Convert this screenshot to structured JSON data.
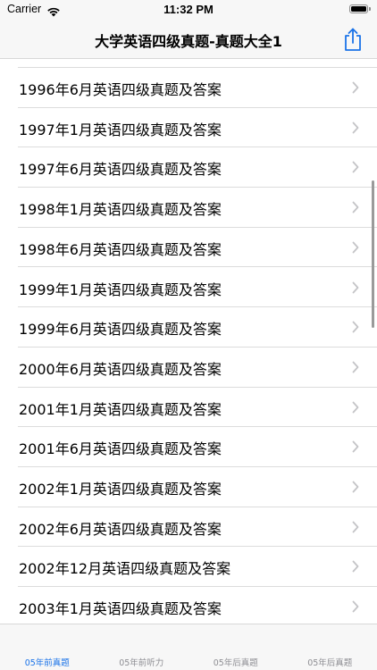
{
  "status_bar": {
    "carrier": "Carrier",
    "time": "11:32 PM"
  },
  "nav": {
    "title": "大学英语四级真题-真题大全1",
    "share_icon": "share-icon"
  },
  "accent_color": "#1a73e8",
  "list": {
    "items": [
      {
        "label": "1996年6月英语四级真题及答案"
      },
      {
        "label": "1997年1月英语四级真题及答案"
      },
      {
        "label": "1997年6月英语四级真题及答案"
      },
      {
        "label": "1998年1月英语四级真题及答案"
      },
      {
        "label": "1998年6月英语四级真题及答案"
      },
      {
        "label": "1999年1月英语四级真题及答案"
      },
      {
        "label": "1999年6月英语四级真题及答案"
      },
      {
        "label": "2000年6月英语四级真题及答案"
      },
      {
        "label": "2001年1月英语四级真题及答案"
      },
      {
        "label": "2001年6月英语四级真题及答案"
      },
      {
        "label": "2002年1月英语四级真题及答案"
      },
      {
        "label": "2002年6月英语四级真题及答案"
      },
      {
        "label": "2002年12月英语四级真题及答案"
      },
      {
        "label": "2003年1月英语四级真题及答案"
      }
    ]
  },
  "tabs": [
    {
      "label": "05年前真题",
      "active": true
    },
    {
      "label": "05年前听力",
      "active": false
    },
    {
      "label": "05年后真题",
      "active": false
    },
    {
      "label": "05年后真题",
      "active": false
    }
  ]
}
